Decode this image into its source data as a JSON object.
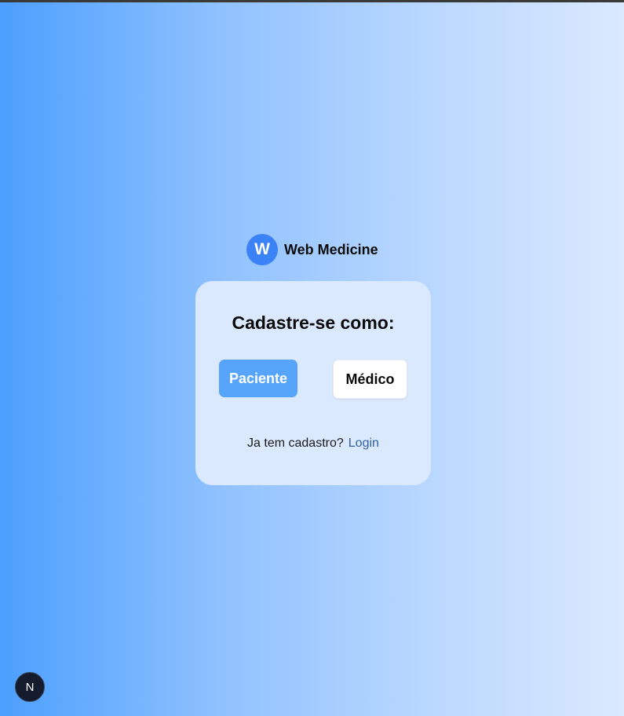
{
  "brand": {
    "logo_letter": "W",
    "name": "Web Medicine"
  },
  "card": {
    "title": "Cadastre-se como:",
    "patient_button": "Paciente",
    "doctor_button": "Médico",
    "login_question": "Ja tem cadastro?",
    "login_link": "Login"
  },
  "nav_badge": {
    "letter": "N"
  },
  "colors": {
    "accent": "#3b82f6",
    "primary_button": "#57a5fb",
    "card_background": "#dbe9fe",
    "link": "#2e5fa8",
    "gradient_start": "#4c9ffe",
    "gradient_end": "#dbe9fe"
  }
}
